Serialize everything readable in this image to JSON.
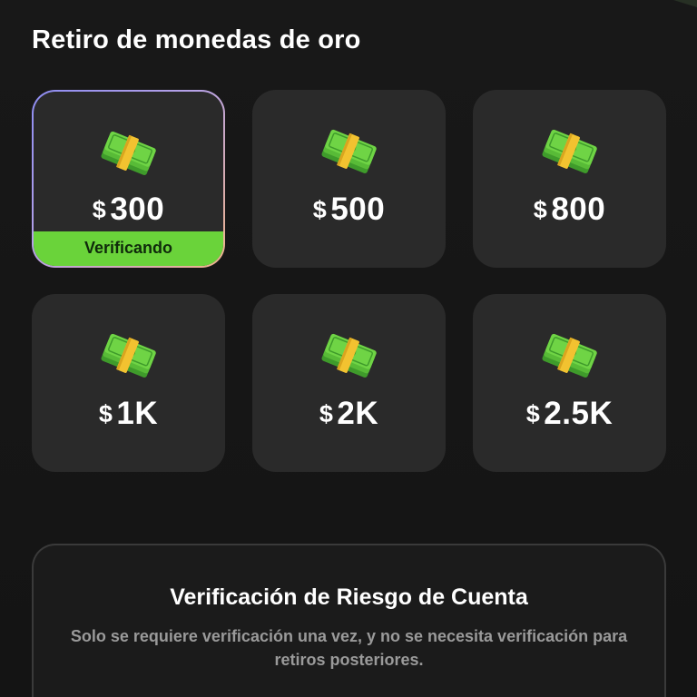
{
  "header": {
    "title": "Retiro de monedas de oro"
  },
  "currency_symbol": "$",
  "options": [
    {
      "amount": "300",
      "status": "Verificando",
      "selected": true
    },
    {
      "amount": "500",
      "status": "",
      "selected": false
    },
    {
      "amount": "800",
      "status": "",
      "selected": false
    },
    {
      "amount": "1K",
      "status": "",
      "selected": false
    },
    {
      "amount": "2K",
      "status": "",
      "selected": false
    },
    {
      "amount": "2.5K",
      "status": "",
      "selected": false
    }
  ],
  "verification": {
    "title": "Verificación de Riesgo de Cuenta",
    "description": "Solo se requiere verificación una vez, y no se necesita verificación para retiros posteriores."
  },
  "colors": {
    "background": "#151515",
    "card": "#2a2a2a",
    "accent_green": "#6ad33a",
    "muted_text": "#9a9a9a",
    "border_gradient_start": "#8d8cf2",
    "border_gradient_end": "#f0b48a"
  },
  "icons": {
    "option_icon": "money-bundle-icon"
  }
}
